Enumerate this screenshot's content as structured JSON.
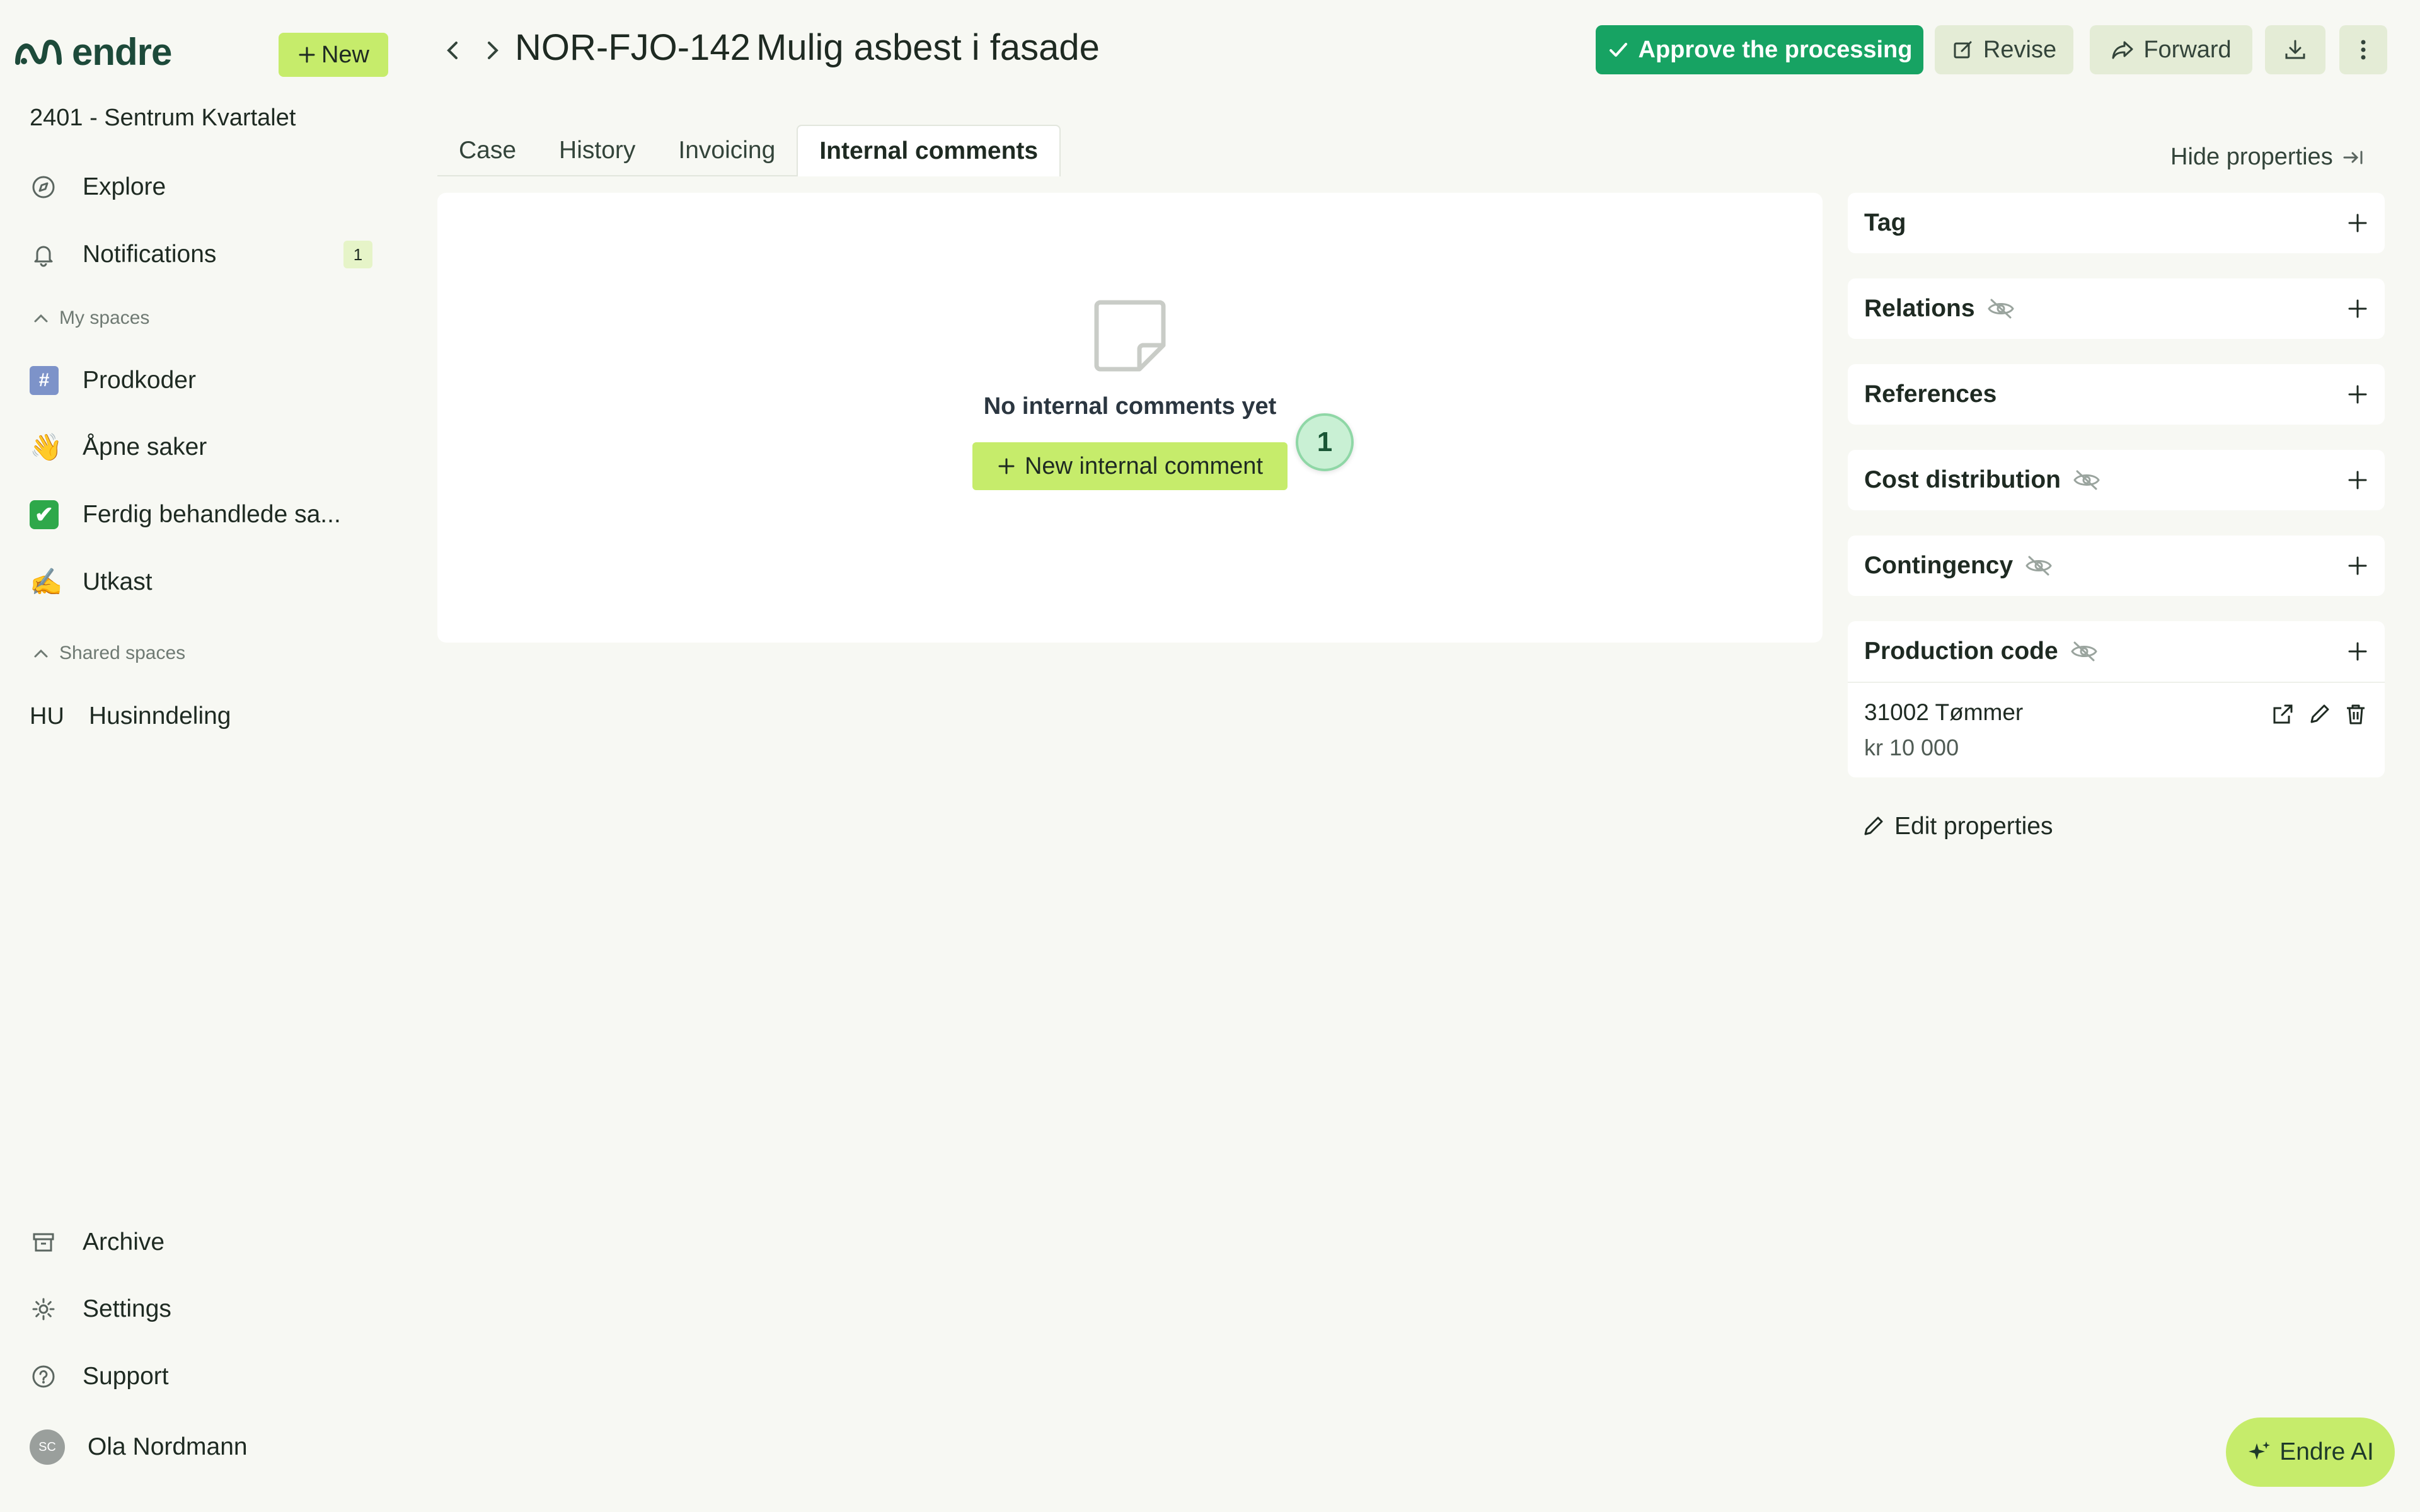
{
  "app": {
    "logo_text": "endre",
    "new_label": "New"
  },
  "sidebar": {
    "project": "2401 - Sentrum Kvartalet",
    "explore": "Explore",
    "notifications": "Notifications",
    "notifications_count": "1",
    "my_spaces_label": "My spaces",
    "my_spaces": [
      {
        "label": "Prodkoder",
        "icon": "hash"
      },
      {
        "label": "Åpne saker",
        "icon": "👋"
      },
      {
        "label": "Ferdig behandlede sa...",
        "icon": "✔"
      },
      {
        "label": "Utkast",
        "icon": "✍️"
      }
    ],
    "shared_spaces_label": "Shared spaces",
    "shared_spaces": [
      {
        "abbr": "HU",
        "label": "Husinndeling"
      }
    ],
    "archive": "Archive",
    "settings": "Settings",
    "support": "Support",
    "user": {
      "initials": "SC",
      "name": "Ola Nordmann"
    }
  },
  "header": {
    "case_id": "NOR-FJO-142",
    "case_title": "Mulig asbest i fasade",
    "approve_label": "Approve the processing",
    "revise_label": "Revise",
    "forward_label": "Forward"
  },
  "tabs": [
    "Case",
    "History",
    "Invoicing",
    "Internal comments"
  ],
  "active_tab": "Internal comments",
  "comments": {
    "empty_text": "No internal comments yet",
    "new_label": "New internal comment",
    "step_marker": "1"
  },
  "properties": {
    "hide_label": "Hide properties",
    "tag": "Tag",
    "relations": "Relations",
    "references": "References",
    "cost_distribution": "Cost distribution",
    "contingency": "Contingency",
    "production_code": "Production code",
    "production_item": {
      "name": "31002 Tømmer",
      "amount": "kr 10 000"
    },
    "edit_label": "Edit properties"
  },
  "ai": {
    "label": "Endre AI"
  },
  "colors": {
    "accent": "#c6ec6b",
    "approve": "#17a363",
    "background": "#f7f8f3"
  }
}
